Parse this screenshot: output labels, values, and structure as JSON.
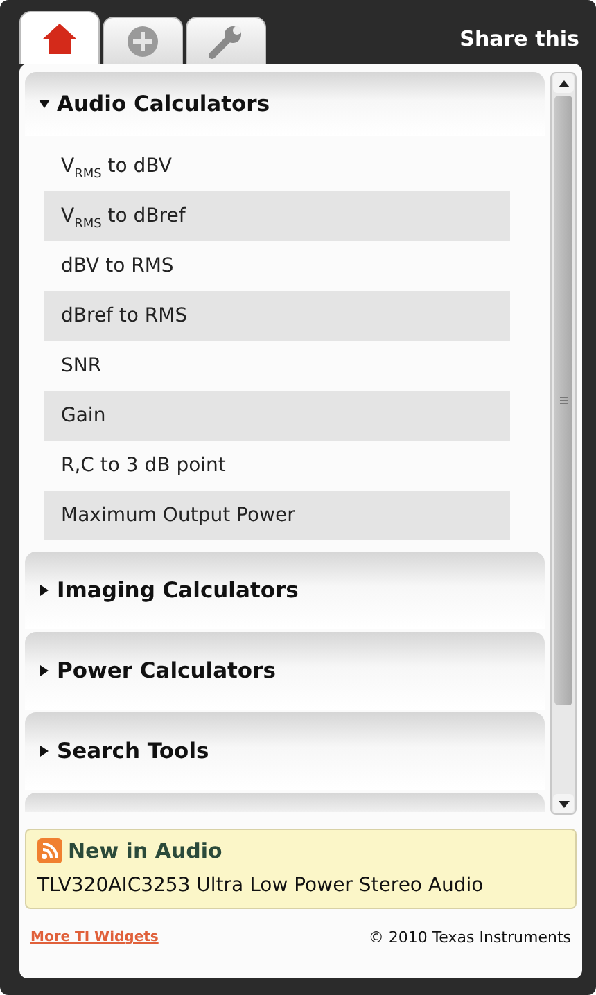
{
  "tabs": [
    {
      "kind": "home",
      "selected": true
    },
    {
      "kind": "plus",
      "selected": false
    },
    {
      "kind": "wrench",
      "selected": false
    }
  ],
  "share": "Share this",
  "sections": [
    {
      "title": "Audio Calculators",
      "expanded": true,
      "items": [
        "V$_{RMS}$ to dBV",
        "V$_{RMS}$ to dBref",
        "dBV to RMS",
        "dBref to RMS",
        "SNR",
        "Gain",
        "R,C to 3 dB point",
        "Maximum Output Power"
      ]
    },
    {
      "title": "Imaging Calculators",
      "expanded": false
    },
    {
      "title": "Power Calculators",
      "expanded": false
    },
    {
      "title": "Search Tools",
      "expanded": false
    }
  ],
  "news": {
    "title": "New in Audio",
    "text": "TLV320AIC3253 Ultra Low Power Stereo Audio"
  },
  "footer": {
    "link": "More TI Widgets",
    "copyright": "© 2010 Texas Instruments"
  }
}
